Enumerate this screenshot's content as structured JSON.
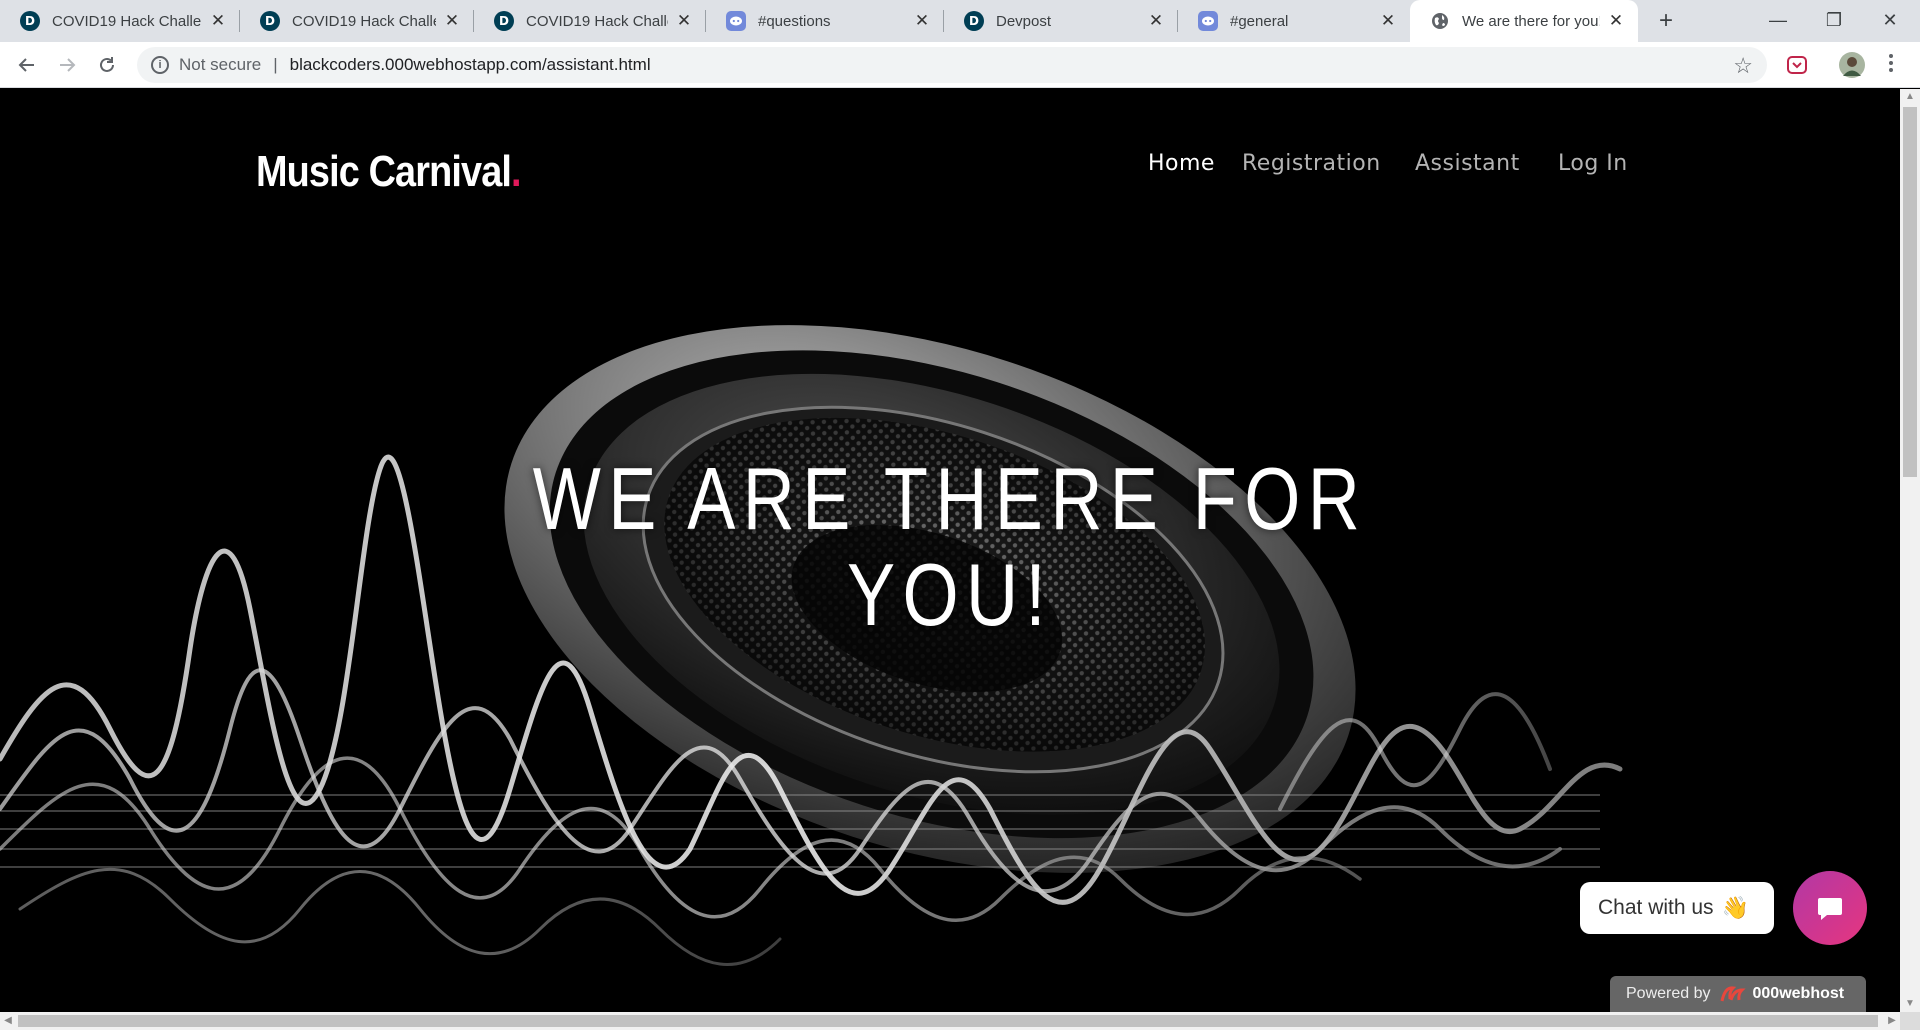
{
  "browser": {
    "tabs": [
      {
        "title": "COVID19 Hack Challenge",
        "icon": "devpost-icon"
      },
      {
        "title": "COVID19 Hack Challenge",
        "icon": "devpost-icon"
      },
      {
        "title": "COVID19 Hack Challenge",
        "icon": "devpost-icon"
      },
      {
        "title": "#questions",
        "icon": "discord-icon"
      },
      {
        "title": "Devpost",
        "icon": "devpost-icon"
      },
      {
        "title": "#general",
        "icon": "discord-icon"
      },
      {
        "title": "We are there for you!",
        "icon": "globe-icon"
      }
    ],
    "devpost_letter": "D",
    "new_tab_symbol": "+",
    "close_symbol": "✕",
    "address": {
      "security_label": "Not secure",
      "separator": "|",
      "url": "blackcoders.000webhostapp.com/assistant.html"
    },
    "window_controls": {
      "minimize": "—",
      "restore": "❐",
      "close": "✕"
    }
  },
  "site": {
    "logo": {
      "text": "Music Carnival",
      "dot": "."
    },
    "nav": [
      {
        "label": "Home",
        "active": true
      },
      {
        "label": "Registration",
        "active": false
      },
      {
        "label": "Assistant",
        "active": false
      },
      {
        "label": "Log In",
        "active": false
      }
    ],
    "hero": {
      "line1": "WE ARE THERE FOR",
      "line2": "YOU!"
    },
    "chat": {
      "bubble_text": "Chat with us",
      "emoji": "👋"
    },
    "powered": {
      "prefix": "Powered by",
      "brand": "000webhost"
    }
  },
  "colors": {
    "accent": "#e0195a",
    "chat_gradient_start": "#b238a5",
    "chat_gradient_end": "#e6357f"
  }
}
